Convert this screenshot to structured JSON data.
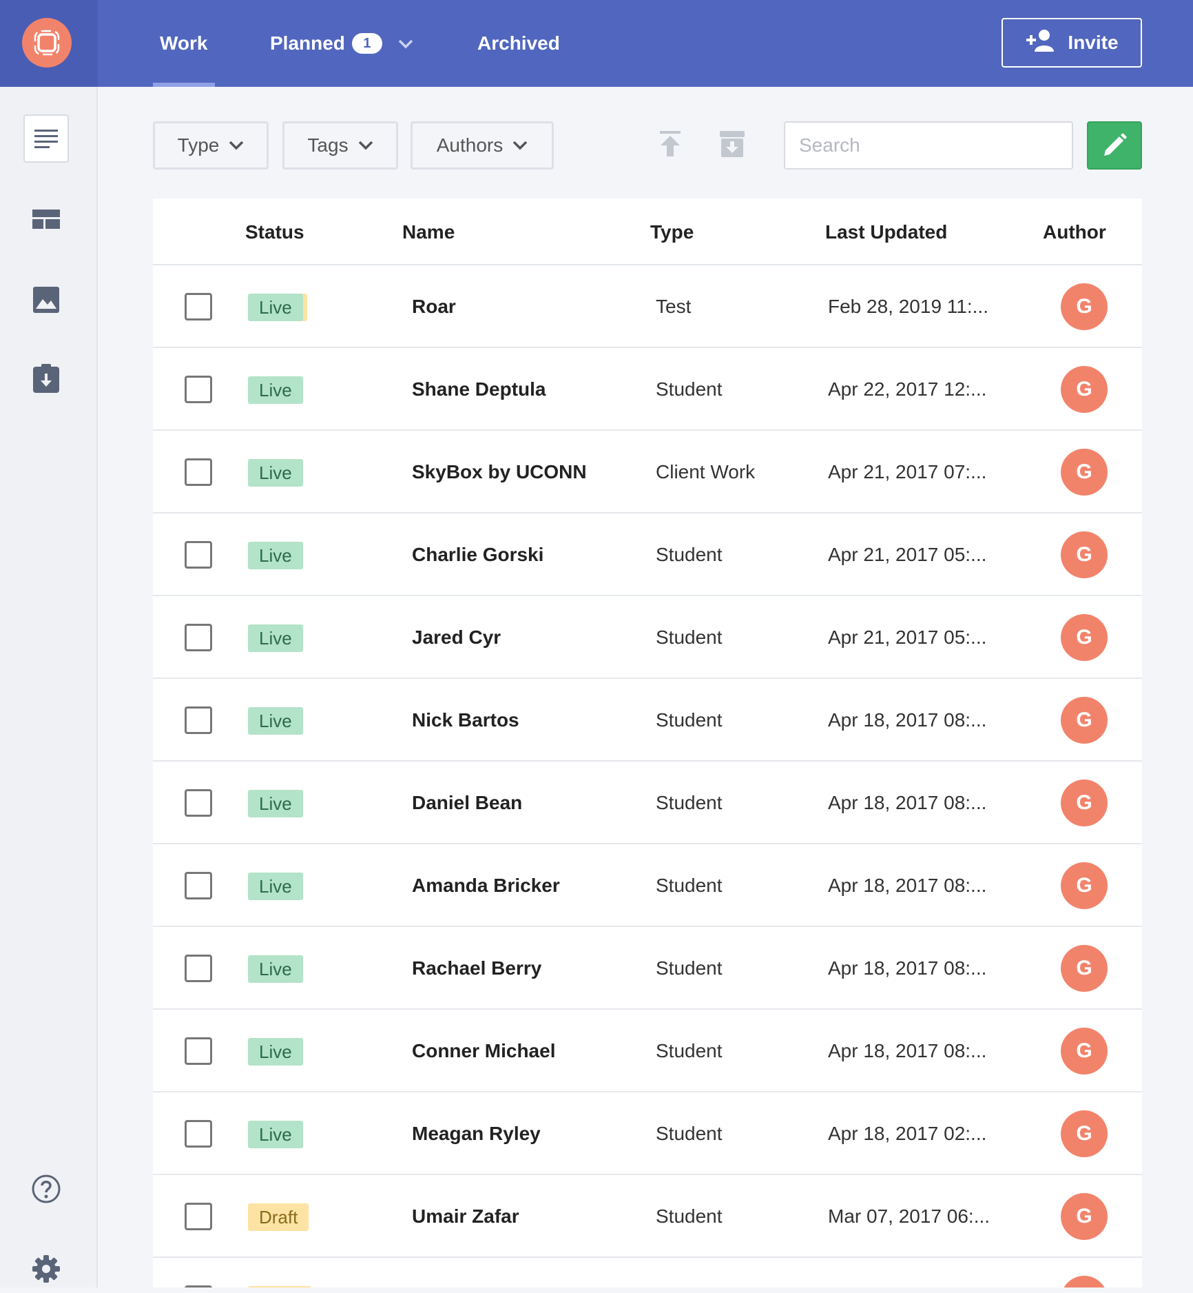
{
  "nav": {
    "tabs": [
      {
        "label": "Work"
      },
      {
        "label": "Planned",
        "badge": "1"
      },
      {
        "label": "Archived"
      }
    ],
    "invite_label": "Invite"
  },
  "filters": {
    "type_label": "Type",
    "tags_label": "Tags",
    "authors_label": "Authors",
    "search_placeholder": "Search"
  },
  "table": {
    "headers": {
      "status": "Status",
      "name": "Name",
      "type": "Type",
      "last_updated": "Last Updated",
      "author": "Author"
    },
    "rows": [
      {
        "status": "Live",
        "name": "Roar",
        "type": "Test",
        "date": "Feb 28, 2019 11:...",
        "author": "G"
      },
      {
        "status": "Live",
        "name": "Shane Deptula",
        "type": "Student",
        "date": "Apr 22, 2017 12:...",
        "author": "G"
      },
      {
        "status": "Live",
        "name": "SkyBox by UCONN",
        "type": "Client Work",
        "date": "Apr 21, 2017 07:...",
        "author": "G"
      },
      {
        "status": "Live",
        "name": "Charlie Gorski",
        "type": "Student",
        "date": "Apr 21, 2017 05:...",
        "author": "G"
      },
      {
        "status": "Live",
        "name": "Jared Cyr",
        "type": "Student",
        "date": "Apr 21, 2017 05:...",
        "author": "G"
      },
      {
        "status": "Live",
        "name": "Nick Bartos",
        "type": "Student",
        "date": "Apr 18, 2017 08:...",
        "author": "G"
      },
      {
        "status": "Live",
        "name": "Daniel Bean",
        "type": "Student",
        "date": "Apr 18, 2017 08:...",
        "author": "G"
      },
      {
        "status": "Live",
        "name": "Amanda Bricker",
        "type": "Student",
        "date": "Apr 18, 2017 08:...",
        "author": "G"
      },
      {
        "status": "Live",
        "name": "Rachael Berry",
        "type": "Student",
        "date": "Apr 18, 2017 08:...",
        "author": "G"
      },
      {
        "status": "Live",
        "name": "Conner Michael",
        "type": "Student",
        "date": "Apr 18, 2017 08:...",
        "author": "G"
      },
      {
        "status": "Live",
        "name": "Meagan Ryley",
        "type": "Student",
        "date": "Apr 18, 2017 02:...",
        "author": "G"
      },
      {
        "status": "Draft",
        "name": "Umair Zafar",
        "type": "Student",
        "date": "Mar 07, 2017 06:...",
        "author": "G"
      }
    ]
  },
  "colors": {
    "nav_bg": "#5166be",
    "accent_orange": "#f2836b",
    "live_bg": "#b3e3c8",
    "draft_bg": "#fde3a3",
    "edit_green": "#3fb36a"
  }
}
